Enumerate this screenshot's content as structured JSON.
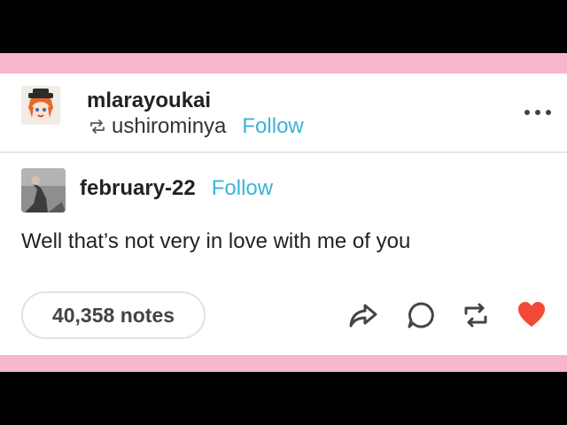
{
  "post": {
    "reblogger": "mlarayoukai",
    "reblogged_from": "ushirominya",
    "follow_label_1": "Follow",
    "original_author": "february-22",
    "follow_label_2": "Follow",
    "body": "Well that’s not very in love with me of you",
    "notes": "40,358 notes"
  },
  "colors": {
    "accent_follow": "#3bb3d9",
    "band_pink": "#f7b6cc",
    "like_red": "#f24a36"
  },
  "icons": [
    "reblog-small-icon",
    "more-options-icon",
    "share-icon",
    "reply-icon",
    "reblog-icon",
    "like-heart-icon"
  ]
}
